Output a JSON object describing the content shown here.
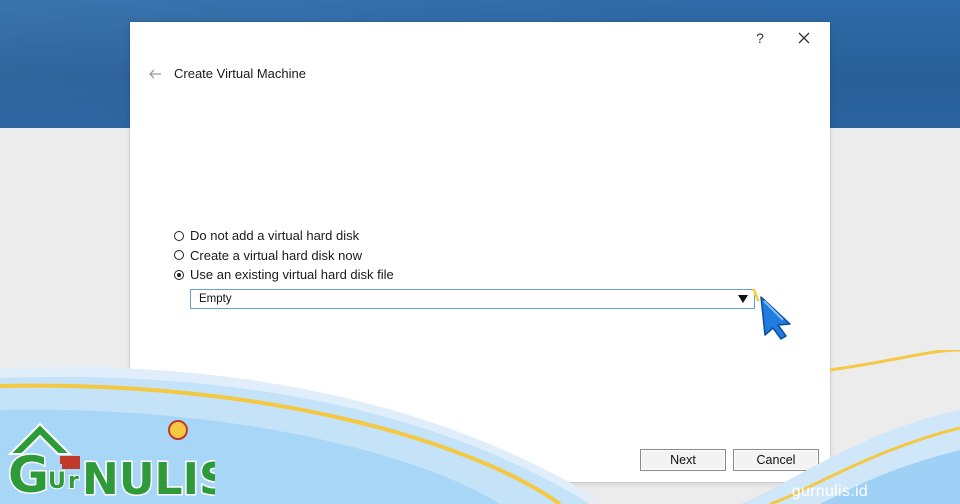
{
  "dialog": {
    "title": "Create Virtual Machine",
    "help_label": "?",
    "icons": {
      "back": "back-arrow-icon",
      "close": "close-icon"
    }
  },
  "disk_options": [
    {
      "label": "Do not add a virtual hard disk",
      "selected": false
    },
    {
      "label": "Create a virtual hard disk now",
      "selected": false
    },
    {
      "label": "Use an existing virtual hard disk file",
      "selected": true
    }
  ],
  "disk_file_select": {
    "value": "Empty"
  },
  "buttons": {
    "next": "Next",
    "cancel": "Cancel"
  },
  "watermark": {
    "logo_text": "GURNULIS",
    "site": "gurnulis.id"
  },
  "colors": {
    "header_blue": "#2a63a0",
    "combo_border": "#6aa0cc",
    "cursor_blue": "#1f7be0",
    "wave_yellow": "#f5c842",
    "wave_blue": "#9fd0f5"
  }
}
